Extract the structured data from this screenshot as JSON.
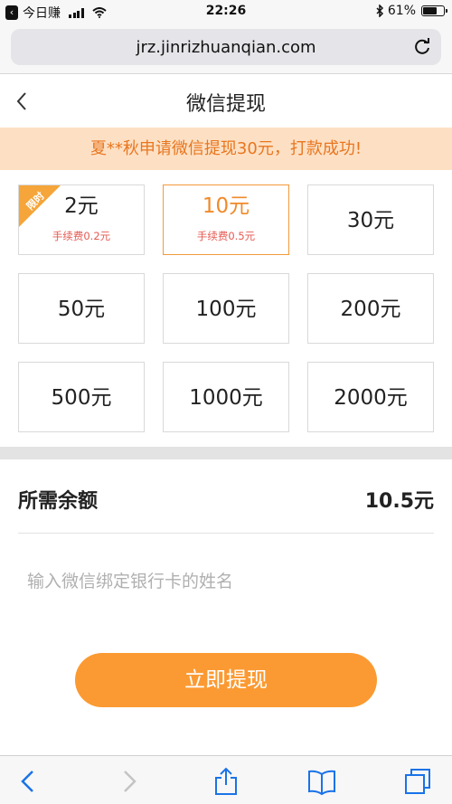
{
  "status_bar": {
    "app_back_label": "今日赚",
    "time": "22:26",
    "battery_percent": "61%",
    "battery_level": 0.61
  },
  "browser": {
    "url": "jrz.jinrizhuanqian.com"
  },
  "header": {
    "title": "微信提现"
  },
  "notice": {
    "text": "夏**秋申请微信提现30元，打款成功!"
  },
  "amount_options": [
    {
      "amount": "2元",
      "fee": "手续费0.2元",
      "badge": "限时",
      "selected": false
    },
    {
      "amount": "10元",
      "fee": "手续费0.5元",
      "selected": true
    },
    {
      "amount": "30元"
    },
    {
      "amount": "50元"
    },
    {
      "amount": "100元"
    },
    {
      "amount": "200元"
    },
    {
      "amount": "500元"
    },
    {
      "amount": "1000元"
    },
    {
      "amount": "2000元"
    }
  ],
  "balance": {
    "label": "所需余额",
    "value": "10.5元"
  },
  "name_input": {
    "placeholder": "输入微信绑定银行卡的姓名",
    "value": ""
  },
  "submit": {
    "label": "立即提现"
  },
  "colors": {
    "accent": "#fb9a32",
    "selected_text": "#f08a2a",
    "fee_text": "#e55a52",
    "notice_bg": "#fde0c4",
    "notice_text": "#e8761f",
    "browser_icon": "#1a73e8"
  },
  "toolbar": {
    "icons": [
      "back-icon",
      "forward-icon",
      "share-icon",
      "bookmarks-icon",
      "tabs-icon"
    ]
  }
}
